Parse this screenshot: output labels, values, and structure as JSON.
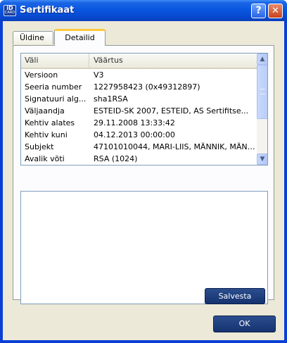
{
  "window": {
    "title": "Sertifikaat",
    "icon_text": "iD",
    "icon_subtext": "CARD",
    "help_label": "?",
    "close_label": "✕"
  },
  "tabs": [
    {
      "label": "Üldine",
      "active": false
    },
    {
      "label": "Detailid",
      "active": true
    }
  ],
  "details_list": {
    "columns": {
      "field": "Väli",
      "value": "Väärtus"
    },
    "rows": [
      {
        "field": "Versioon",
        "value": "V3"
      },
      {
        "field": "Seeria number",
        "value": "1227958423 (0x49312897)"
      },
      {
        "field": "Signatuuri alg...",
        "value": "sha1RSA"
      },
      {
        "field": "Väljaandja",
        "value": "ESTEID-SK 2007, ESTEID, AS Sertifitse..."
      },
      {
        "field": "Kehtiv alates",
        "value": "29.11.2008 13:33:42"
      },
      {
        "field": "Kehtiv kuni",
        "value": "04.12.2013 00:00:00"
      },
      {
        "field": "Subjekt",
        "value": "47101010044, MARI-LIIS, MÄNNIK, MÄNNI..."
      },
      {
        "field": "Avalik võti",
        "value": "RSA (1024)"
      }
    ]
  },
  "buttons": {
    "save": "Salvesta",
    "ok": "OK"
  },
  "icons": {
    "scroll_up": "▲",
    "scroll_down": "▼"
  }
}
